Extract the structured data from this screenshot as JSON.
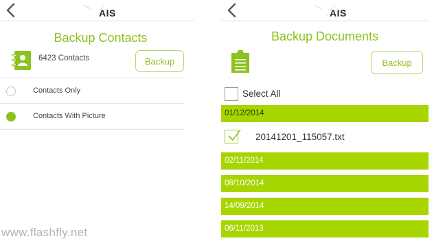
{
  "left_screen": {
    "logo_text": "AIS",
    "title": "Backup Contacts",
    "contacts_count": "6423 Contacts",
    "backup_label": "Backup",
    "options": [
      {
        "label": "Contacts Only",
        "selected": false
      },
      {
        "label": "Contacts With Picture",
        "selected": true
      }
    ]
  },
  "right_screen": {
    "logo_text": "AIS",
    "title": "Backup Documents",
    "backup_label": "Backup",
    "select_all_label": "Select All",
    "groups": [
      {
        "date": "01/12/2014",
        "files": [
          "20141201_115057.txt"
        ]
      },
      {
        "date": "02/11/2014"
      },
      {
        "date": "08/10/2014"
      },
      {
        "date": "14/09/2014"
      },
      {
        "date": "06/11/2013"
      }
    ]
  },
  "watermark": "www.flashfly.net",
  "colors": {
    "accent_green": "#8dc21f",
    "date_bar_green": "#a7d500",
    "button_border": "#b5d869",
    "logo_green": "#8dc21f"
  },
  "icons": {
    "back": "chevron-left-icon",
    "logo": "ais-swoosh-logo",
    "contacts": "contacts-book-icon",
    "documents": "document-clipboard-icon",
    "check": "check-icon"
  }
}
